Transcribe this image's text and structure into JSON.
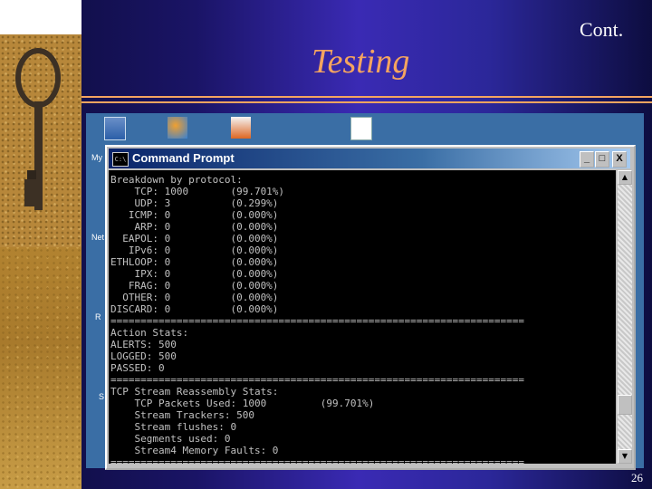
{
  "slide": {
    "cont_label": "Cont.",
    "title": "Testing",
    "page_number": "26"
  },
  "desktop": {
    "icon_labels": [
      "My",
      "Net",
      "R",
      "S"
    ]
  },
  "window": {
    "title": "Command Prompt",
    "app_icon_text": "C:\\",
    "buttons": {
      "minimize": "_",
      "maximize": "□",
      "close": "X"
    }
  },
  "console_lines": [
    "Breakdown by protocol:",
    "    TCP: 1000       (99.701%)",
    "    UDP: 3          (0.299%)",
    "   ICMP: 0          (0.000%)",
    "    ARP: 0          (0.000%)",
    "  EAPOL: 0          (0.000%)",
    "   IPv6: 0          (0.000%)",
    "ETHLOOP: 0          (0.000%)",
    "    IPX: 0          (0.000%)",
    "   FRAG: 0          (0.000%)",
    "  OTHER: 0          (0.000%)",
    "DISCARD: 0          (0.000%)",
    "=====================================================================",
    "Action Stats:",
    "ALERTS: 500",
    "LOGGED: 500",
    "PASSED: 0",
    "=====================================================================",
    "TCP Stream Reassembly Stats:",
    "    TCP Packets Used: 1000         (99.701%)",
    "    Stream Trackers: 500",
    "    Stream flushes: 0",
    "    Segments used: 0",
    "    Stream4 Memory Faults: 0",
    "====================================================================="
  ],
  "scrollbar": {
    "up": "▲",
    "down": "▼"
  }
}
